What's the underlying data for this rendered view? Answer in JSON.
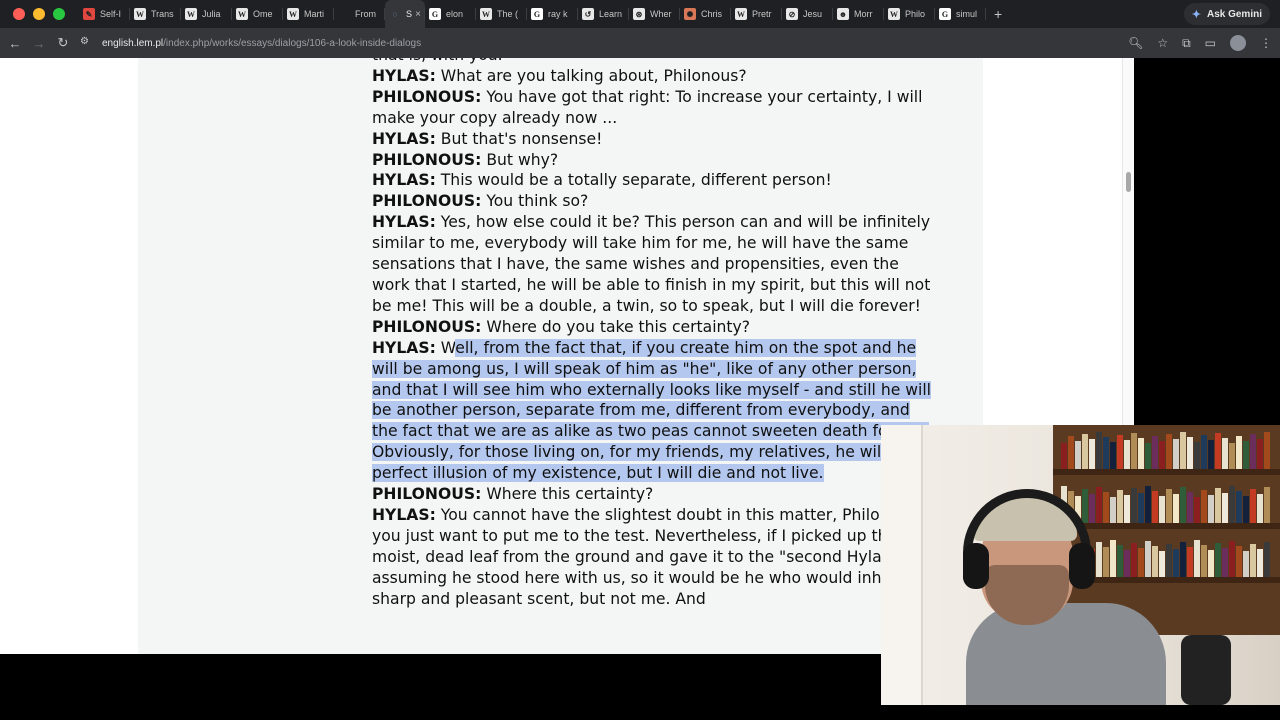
{
  "browser": {
    "tabs": [
      {
        "label": "Self-I",
        "icon": "red-pen-icon"
      },
      {
        "label": "Trans",
        "icon": "wikipedia-icon"
      },
      {
        "label": "Julia",
        "icon": "wikipedia-icon"
      },
      {
        "label": "Ome",
        "icon": "wikipedia-icon"
      },
      {
        "label": "Marti",
        "icon": "wikipedia-icon"
      },
      {
        "label": "From",
        "icon": "blank-icon"
      },
      {
        "label": "S",
        "icon": "loading-icon",
        "active": true
      },
      {
        "label": "elon",
        "icon": "google-icon"
      },
      {
        "label": "The (",
        "icon": "wikipedia-icon"
      },
      {
        "label": "ray k",
        "icon": "google-icon"
      },
      {
        "label": "Learn",
        "icon": "learn-icon"
      },
      {
        "label": "Wher",
        "icon": "chatgpt-icon"
      },
      {
        "label": "Chris",
        "icon": "claude-icon"
      },
      {
        "label": "Pretr",
        "icon": "wikipedia-icon"
      },
      {
        "label": "Jesu",
        "icon": "perplexity-icon"
      },
      {
        "label": "Morr",
        "icon": "face-icon"
      },
      {
        "label": "Philo",
        "icon": "wikipedia-icon"
      },
      {
        "label": "simul",
        "icon": "google-icon"
      }
    ],
    "ask_gemini": "Ask Gemini",
    "url_host": "english.lem.pl",
    "url_path": "/index.php/works/essays/dialogs/106-a-look-inside-dialogs"
  },
  "article": {
    "lines": [
      {
        "speaker": "",
        "text": "that is, with you.",
        "selected": false
      },
      {
        "speaker": "HYLAS:",
        "text": " What are you talking about, Philonous?",
        "selected": false
      },
      {
        "speaker": "PHILONOUS:",
        "text": " You have got that right: To increase your certainty, I will make your copy already now ...",
        "selected": false
      },
      {
        "speaker": "HYLAS:",
        "text": " But that's nonsense!",
        "selected": false
      },
      {
        "speaker": "PHILONOUS:",
        "text": " But why?",
        "selected": false
      },
      {
        "speaker": "HYLAS:",
        "text": " This would be a totally separate, different person!",
        "selected": false
      },
      {
        "speaker": "PHILONOUS:",
        "text": " You think so?",
        "selected": false
      },
      {
        "speaker": "HYLAS:",
        "text": " Yes, how else could it be? This person can and will be infinitely similar to me, everybody will take him for me, he will have the same sensations that I have, the same wishes and propensities, even the work that I started, he will be able to finish in my spirit, but this will not be me! This will be a double, a twin, so to speak, but I will die forever!",
        "selected": false
      },
      {
        "speaker": "PHILONOUS:",
        "text": " Where do you take this certainty?",
        "selected": false
      },
      {
        "speaker": "HYLAS:",
        "text": " W",
        "selected_text": "ell, from the fact that, if you create him on the spot and he will be among us, I will speak of him as \"he\", like of any other person, and that I will see him who externally looks like myself - and still he will be another person, separate from me, different from everybody, and the fact that we are as alike as two peas cannot sweeten death for me. Obviously, for those living on, for my friends, my relatives, he will be a perfect illusion of my existence, but I will die and not live.",
        "selected": true
      },
      {
        "speaker": "PHILONOUS:",
        "text": " Where this certainty?",
        "selected": false
      },
      {
        "speaker": "HYLAS:",
        "text": " You cannot have the slightest doubt in this matter, Philonous, you just want to put me to the test. Nevertheless, if I picked up this moist, dead leaf from the ground and gave it to the \"second Hylas\", assuming he stood here with us, so it would be he who would inhale its sharp and pleasant scent, but not me. And",
        "selected": false
      }
    ]
  },
  "colors": {
    "selection": "#b4c8ef",
    "page_background": "#f4f6f5",
    "browser_frame": "#35363a"
  }
}
